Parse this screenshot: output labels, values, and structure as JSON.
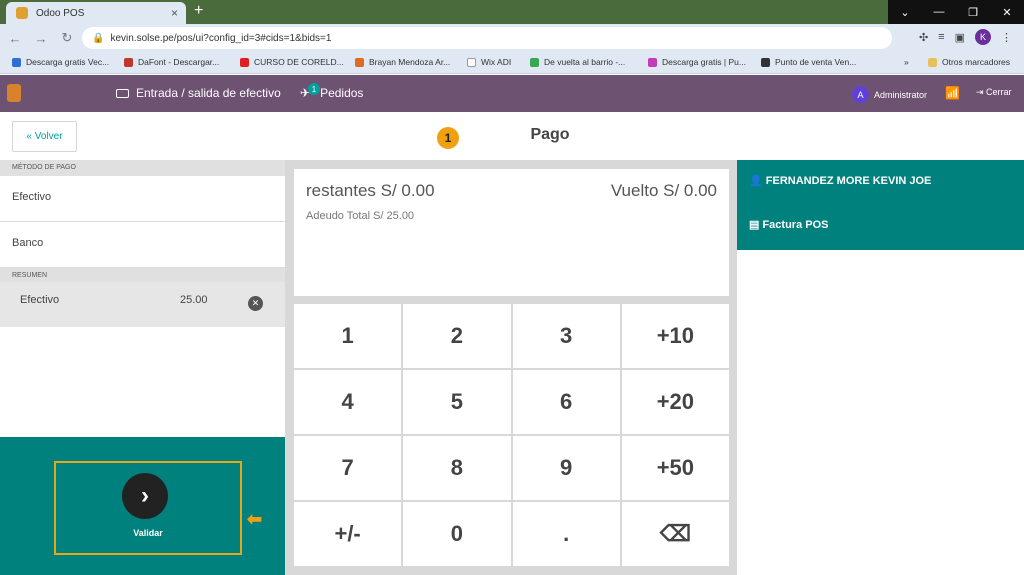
{
  "browser": {
    "tab_title": "Odoo POS",
    "url": "kevin.solse.pe/pos/ui?config_id=3#cids=1&bids=1",
    "bookmarks": [
      "Descarga gratis Vec...",
      "DaFont - Descargar...",
      "CURSO DE CORELD...",
      "Brayan Mendoza Ar...",
      "Wix ADI",
      "De vuelta al barrio -...",
      "Descarga gratis | Pu...",
      "Punto de venta Ven..."
    ],
    "other_bookmarks": "Otros marcadores",
    "profile_initial": "K"
  },
  "app_bar": {
    "cash_label": "Entrada / salida de efectivo",
    "orders_label": "Pedidos",
    "orders_count": "1",
    "user_initial": "A",
    "user_name": "Administrator",
    "logout_label": "Cerrar"
  },
  "subheader": {
    "back_label": "« Volver",
    "step_number": "1",
    "title": "Pago"
  },
  "payment_methods": {
    "heading": "MÉTODO DE PAGO",
    "items": [
      "Efectivo",
      "Banco"
    ]
  },
  "summary": {
    "heading": "RESUMEN",
    "line_method": "Efectivo",
    "line_amount": "25.00"
  },
  "validate": {
    "label": "Validar"
  },
  "status": {
    "remaining": "restantes S/ 0.00",
    "change": "Vuelto S/ 0.00",
    "total_due": "Adeudo Total  S/ 25.00"
  },
  "keypad": [
    "1",
    "2",
    "3",
    "+10",
    "4",
    "5",
    "6",
    "+20",
    "7",
    "8",
    "9",
    "+50",
    "+/-",
    "0",
    ".",
    "⌫"
  ],
  "customer": {
    "name": "FERNANDEZ MORE KEVIN JOE",
    "invoice_label": "Factura POS"
  },
  "colors": {
    "app_bar": "#6e5272",
    "teal": "#00817d",
    "accent": "#f0a010"
  }
}
